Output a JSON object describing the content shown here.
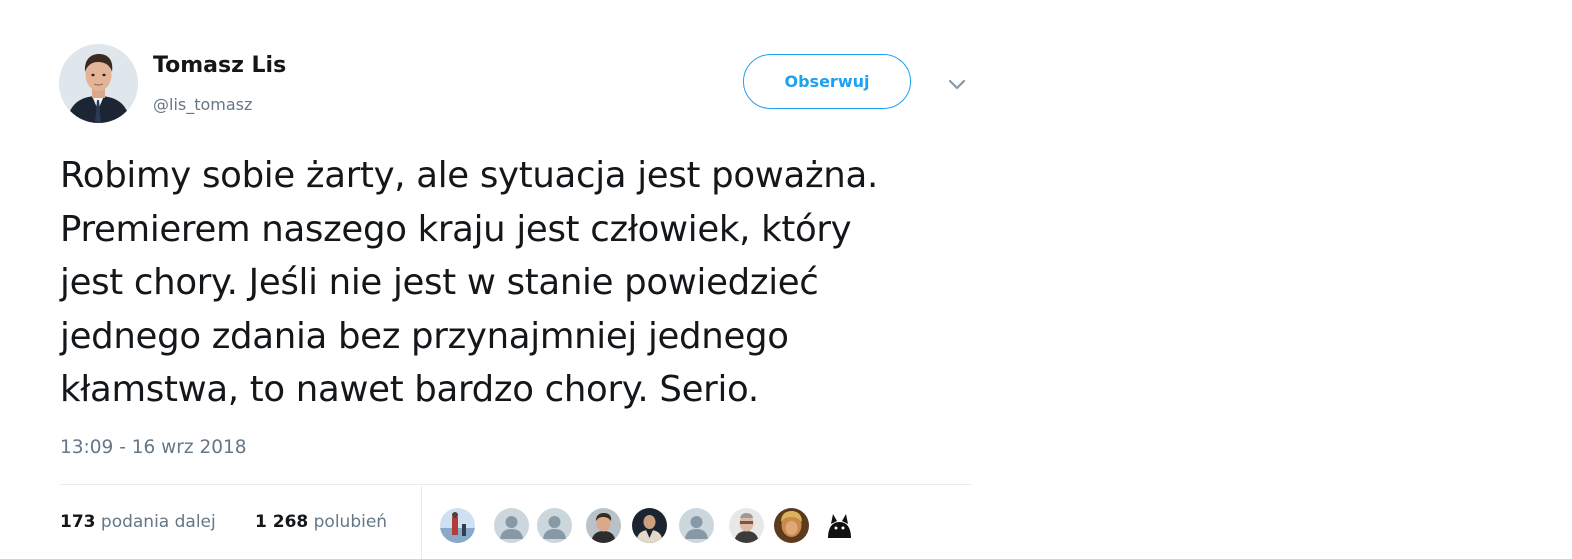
{
  "author": {
    "name": "Tomasz Lis",
    "handle": "@lis_tomasz"
  },
  "follow_button": {
    "label": "Obserwuj"
  },
  "menu_icon": "chevron-down-icon",
  "tweet": {
    "lines": [
      "Robimy sobie żarty, ale sytuacja jest poważna.",
      "Premierem naszego kraju jest człowiek, który",
      "jest chory. Jeśli nie jest w stanie powiedzieć",
      "jednego zdania bez przynajmniej jednego",
      "kłamstwa, to nawet bardzo chory. Serio."
    ],
    "timestamp": "13:09 - 16 wrz 2018"
  },
  "stats": {
    "retweets": {
      "count": "173",
      "label": "podania dalej"
    },
    "likes": {
      "count": "1 268",
      "label": "polubień"
    }
  },
  "colors": {
    "accent": "#1da1f2",
    "text": "#14171a",
    "secondary": "#657786",
    "divider": "#e6ecf0"
  }
}
